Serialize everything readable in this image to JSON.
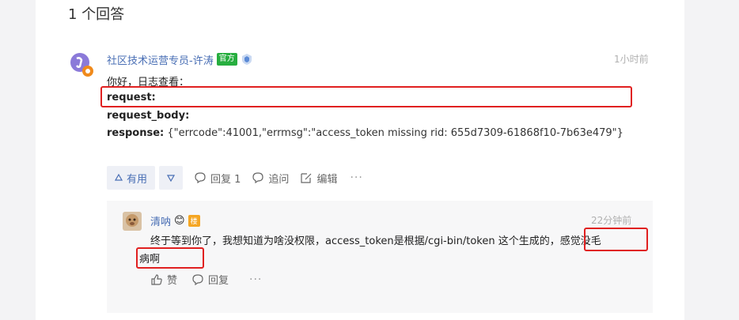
{
  "answers": {
    "count_text": "1 个回答"
  },
  "main_answer": {
    "author": "社区技术运营专员-许涛",
    "official_badge": "官方",
    "time": "1小时前",
    "line1": "你好，日志查看：",
    "line2": "request:",
    "line3": "request_body:",
    "line4_label": "response:",
    "line4_value": " {\"errcode\":41001,\"errmsg\":\"access_token missing rid: 655d7309-61868f10-7b63e479\"}",
    "actions": {
      "useful": "有用",
      "reply": "回复 1",
      "followup": "追问",
      "edit": "编辑",
      "more": "···"
    }
  },
  "reply": {
    "author": "清呐",
    "emoji": "😊",
    "floor_badge": "楼",
    "time": "22分钟前",
    "text_line1": "终于等到你了，我想知道为啥没权限，access_token是根据/cgi-bin/token 这个生成的，感觉没毛",
    "text_line2": "病啊",
    "actions": {
      "like": "赞",
      "reply": "回复",
      "more": "···"
    }
  },
  "colors": {
    "link_blue": "#4a6fb5",
    "official_green": "#27ae3f",
    "highlight_red": "#e02020",
    "floor_orange": "#f5a623"
  }
}
